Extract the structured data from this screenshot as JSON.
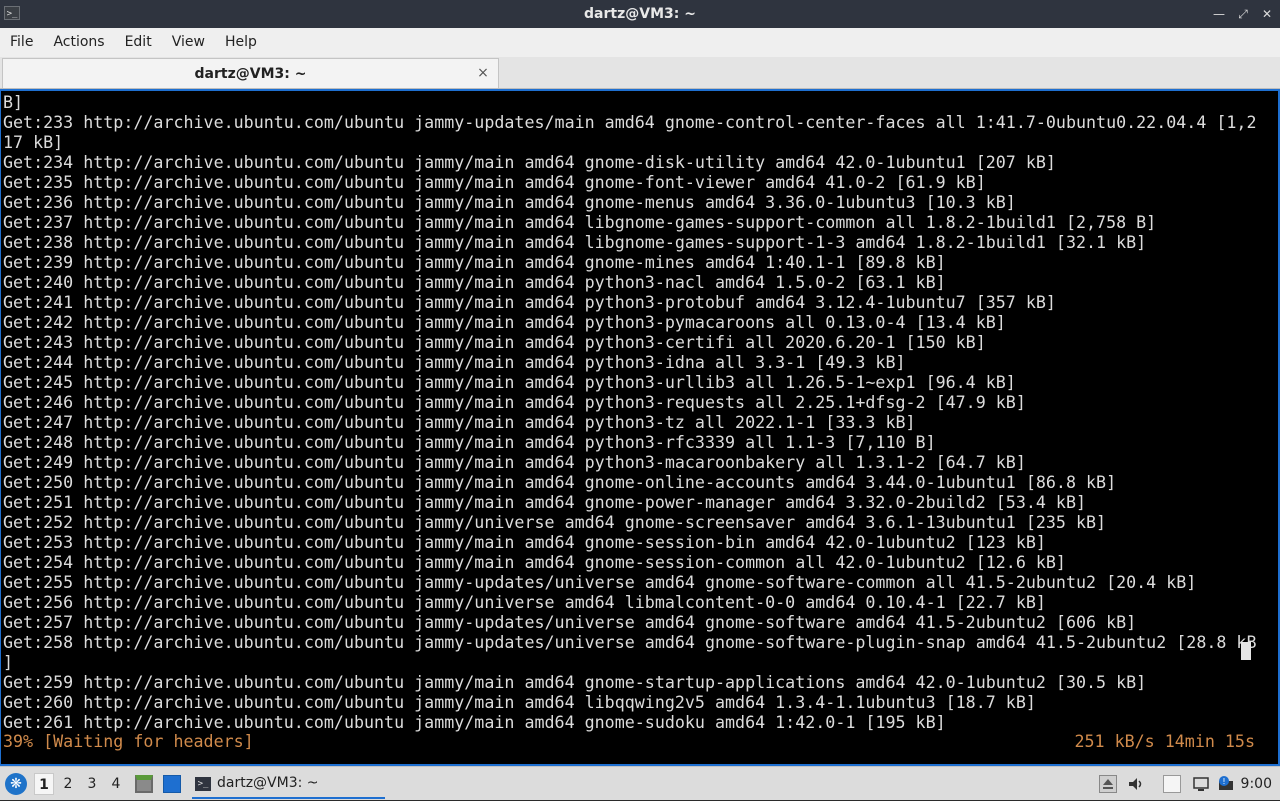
{
  "window": {
    "title": "dartz@VM3: ~",
    "app_icon_glyph": ">_"
  },
  "menu": [
    "File",
    "Actions",
    "Edit",
    "View",
    "Help"
  ],
  "tab": {
    "label": "dartz@VM3: ~",
    "close_glyph": "×"
  },
  "terminal": {
    "lines": [
      "B]",
      "Get:233 http://archive.ubuntu.com/ubuntu jammy-updates/main amd64 gnome-control-center-faces all 1:41.7-0ubuntu0.22.04.4 [1,2",
      "17 kB]",
      "Get:234 http://archive.ubuntu.com/ubuntu jammy/main amd64 gnome-disk-utility amd64 42.0-1ubuntu1 [207 kB]",
      "Get:235 http://archive.ubuntu.com/ubuntu jammy/main amd64 gnome-font-viewer amd64 41.0-2 [61.9 kB]",
      "Get:236 http://archive.ubuntu.com/ubuntu jammy/main amd64 gnome-menus amd64 3.36.0-1ubuntu3 [10.3 kB]",
      "Get:237 http://archive.ubuntu.com/ubuntu jammy/main amd64 libgnome-games-support-common all 1.8.2-1build1 [2,758 B]",
      "Get:238 http://archive.ubuntu.com/ubuntu jammy/main amd64 libgnome-games-support-1-3 amd64 1.8.2-1build1 [32.1 kB]",
      "Get:239 http://archive.ubuntu.com/ubuntu jammy/main amd64 gnome-mines amd64 1:40.1-1 [89.8 kB]",
      "Get:240 http://archive.ubuntu.com/ubuntu jammy/main amd64 python3-nacl amd64 1.5.0-2 [63.1 kB]",
      "Get:241 http://archive.ubuntu.com/ubuntu jammy/main amd64 python3-protobuf amd64 3.12.4-1ubuntu7 [357 kB]",
      "Get:242 http://archive.ubuntu.com/ubuntu jammy/main amd64 python3-pymacaroons all 0.13.0-4 [13.4 kB]",
      "Get:243 http://archive.ubuntu.com/ubuntu jammy/main amd64 python3-certifi all 2020.6.20-1 [150 kB]",
      "Get:244 http://archive.ubuntu.com/ubuntu jammy/main amd64 python3-idna all 3.3-1 [49.3 kB]",
      "Get:245 http://archive.ubuntu.com/ubuntu jammy/main amd64 python3-urllib3 all 1.26.5-1~exp1 [96.4 kB]",
      "Get:246 http://archive.ubuntu.com/ubuntu jammy/main amd64 python3-requests all 2.25.1+dfsg-2 [47.9 kB]",
      "Get:247 http://archive.ubuntu.com/ubuntu jammy/main amd64 python3-tz all 2022.1-1 [33.3 kB]",
      "Get:248 http://archive.ubuntu.com/ubuntu jammy/main amd64 python3-rfc3339 all 1.1-3 [7,110 B]",
      "Get:249 http://archive.ubuntu.com/ubuntu jammy/main amd64 python3-macaroonbakery all 1.3.1-2 [64.7 kB]",
      "Get:250 http://archive.ubuntu.com/ubuntu jammy/main amd64 gnome-online-accounts amd64 3.44.0-1ubuntu1 [86.8 kB]",
      "Get:251 http://archive.ubuntu.com/ubuntu jammy/main amd64 gnome-power-manager amd64 3.32.0-2build2 [53.4 kB]",
      "Get:252 http://archive.ubuntu.com/ubuntu jammy/universe amd64 gnome-screensaver amd64 3.6.1-13ubuntu1 [235 kB]",
      "Get:253 http://archive.ubuntu.com/ubuntu jammy/main amd64 gnome-session-bin amd64 42.0-1ubuntu2 [123 kB]",
      "Get:254 http://archive.ubuntu.com/ubuntu jammy/main amd64 gnome-session-common all 42.0-1ubuntu2 [12.6 kB]",
      "Get:255 http://archive.ubuntu.com/ubuntu jammy-updates/universe amd64 gnome-software-common all 41.5-2ubuntu2 [20.4 kB]",
      "Get:256 http://archive.ubuntu.com/ubuntu jammy/universe amd64 libmalcontent-0-0 amd64 0.10.4-1 [22.7 kB]",
      "Get:257 http://archive.ubuntu.com/ubuntu jammy-updates/universe amd64 gnome-software amd64 41.5-2ubuntu2 [606 kB]",
      "Get:258 http://archive.ubuntu.com/ubuntu jammy-updates/universe amd64 gnome-software-plugin-snap amd64 41.5-2ubuntu2 [28.8 kB",
      "]",
      "Get:259 http://archive.ubuntu.com/ubuntu jammy/main amd64 gnome-startup-applications amd64 42.0-1ubuntu2 [30.5 kB]",
      "Get:260 http://archive.ubuntu.com/ubuntu jammy/main amd64 libqqwing2v5 amd64 1.3.4-1.1ubuntu3 [18.7 kB]",
      "Get:261 http://archive.ubuntu.com/ubuntu jammy/main amd64 gnome-sudoku amd64 1:42.0-1 [195 kB]"
    ],
    "status_left": "39% [Waiting for headers]",
    "status_right": "251 kB/s 14min 15s",
    "status_color": "#d08a4b",
    "accent_color": "#1e6fd0"
  },
  "taskbar": {
    "workspaces": [
      "1",
      "2",
      "3",
      "4"
    ],
    "active_workspace": "1",
    "task_label": "dartz@VM3: ~",
    "clock": "9:00"
  }
}
